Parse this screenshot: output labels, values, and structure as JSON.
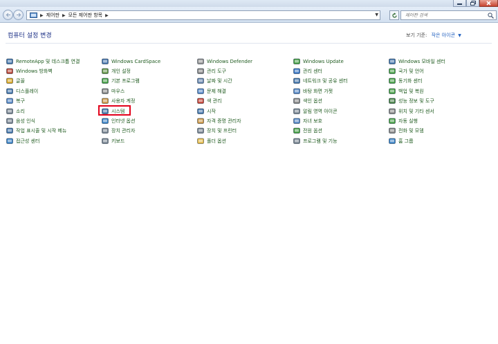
{
  "address": {
    "crumbs": [
      "제어판",
      "모든 제어판 항목"
    ]
  },
  "search": {
    "placeholder": "제어판 검색"
  },
  "content": {
    "title": "컴퓨터 설정 변경",
    "view_by_label": "보기 기준:",
    "view_by_value": "작은 아이콘"
  },
  "items": [
    {
      "label": "RemoteApp 및 데스크톱 연결",
      "icon": "remoteapp-icon",
      "color": "#3a6ea5"
    },
    {
      "label": "Windows 방화벽",
      "icon": "firewall-icon",
      "color": "#b33a2a"
    },
    {
      "label": "글꼴",
      "icon": "fonts-icon",
      "color": "#d4a017"
    },
    {
      "label": "디스플레이",
      "icon": "display-icon",
      "color": "#3a6ea5"
    },
    {
      "label": "복구",
      "icon": "recovery-icon",
      "color": "#4a7fc0"
    },
    {
      "label": "소리",
      "icon": "speaker-icon",
      "color": "#6f7c89"
    },
    {
      "label": "음성 인식",
      "icon": "microphone-icon",
      "color": "#6f7c89"
    },
    {
      "label": "작업 표시줄 및 시작 메뉴",
      "icon": "taskbar-icon",
      "color": "#3a6ea5"
    },
    {
      "label": "접근성 센터",
      "icon": "ease-of-access-icon",
      "color": "#2f7bc1"
    },
    {
      "label": "Windows CardSpace",
      "icon": "cardspace-icon",
      "color": "#3f6fa8"
    },
    {
      "label": "개인 설정",
      "icon": "personalization-icon",
      "color": "#5a8f3c"
    },
    {
      "label": "기본 프로그램",
      "icon": "default-programs-icon",
      "color": "#3c9a3c"
    },
    {
      "label": "마우스",
      "icon": "mouse-icon",
      "color": "#7c7c7c"
    },
    {
      "label": "사용자 계정",
      "icon": "user-accounts-icon",
      "color": "#c58f3a"
    },
    {
      "label": "시스템",
      "icon": "system-icon",
      "color": "#3a6ea5"
    },
    {
      "label": "인터넷 옵션",
      "icon": "internet-options-icon",
      "color": "#2f7bc1"
    },
    {
      "label": "장치 관리자",
      "icon": "device-manager-icon",
      "color": "#6f7c89"
    },
    {
      "label": "키보드",
      "icon": "keyboard-icon",
      "color": "#6f7c89"
    },
    {
      "label": "Windows Defender",
      "icon": "defender-icon",
      "color": "#8a8a8a"
    },
    {
      "label": "관리 도구",
      "icon": "admin-tools-icon",
      "color": "#7c7c7c"
    },
    {
      "label": "날짜 및 시간",
      "icon": "clock-icon",
      "color": "#5d7fa8"
    },
    {
      "label": "문제 해결",
      "icon": "troubleshoot-icon",
      "color": "#4a7fc0"
    },
    {
      "label": "색 관리",
      "icon": "color-management-icon",
      "color": "#c0392b"
    },
    {
      "label": "시작",
      "icon": "getting-started-icon",
      "color": "#3a6ea5"
    },
    {
      "label": "자격 증명 관리자",
      "icon": "credential-manager-icon",
      "color": "#c58f3a"
    },
    {
      "label": "장치 및 프린터",
      "icon": "printer-icon",
      "color": "#6f7c89"
    },
    {
      "label": "폴더 옵션",
      "icon": "folder-icon",
      "color": "#e0b43c"
    },
    {
      "label": "Windows Update",
      "icon": "windows-update-icon",
      "color": "#3c9a3c"
    },
    {
      "label": "관리 센터",
      "icon": "action-center-icon",
      "color": "#2f6fc1"
    },
    {
      "label": "네트워크 및 공유 센터",
      "icon": "network-icon",
      "color": "#3a6ea5"
    },
    {
      "label": "바탕 화면 가젯",
      "icon": "gadgets-icon",
      "color": "#4a7fc0"
    },
    {
      "label": "색인 옵션",
      "icon": "indexing-icon",
      "color": "#7c7c7c"
    },
    {
      "label": "알림 영역 아이콘",
      "icon": "notification-area-icon",
      "color": "#6f7c89"
    },
    {
      "label": "자녀 보호",
      "icon": "parental-controls-icon",
      "color": "#4a7fc0"
    },
    {
      "label": "전원 옵션",
      "icon": "power-icon",
      "color": "#3c9a3c"
    },
    {
      "label": "프로그램 및 기능",
      "icon": "programs-features-icon",
      "color": "#6f7c89"
    },
    {
      "label": "Windows 모바일 센터",
      "icon": "mobility-center-icon",
      "color": "#3a6ea5"
    },
    {
      "label": "국가 및 언어",
      "icon": "region-language-icon",
      "color": "#3c9a3c"
    },
    {
      "label": "동기화 센터",
      "icon": "sync-center-icon",
      "color": "#3c9a3c"
    },
    {
      "label": "백업 및 복원",
      "icon": "backup-icon",
      "color": "#3c9a3c"
    },
    {
      "label": "성능 정보 및 도구",
      "icon": "performance-icon",
      "color": "#3c7a3c"
    },
    {
      "label": "위치 및 기타 센서",
      "icon": "sensors-icon",
      "color": "#7c7c7c"
    },
    {
      "label": "자동 실행",
      "icon": "autoplay-icon",
      "color": "#3c9a3c"
    },
    {
      "label": "전화 및 모뎀",
      "icon": "phone-modem-icon",
      "color": "#7c7c7c"
    },
    {
      "label": "홈 그룹",
      "icon": "homegroup-icon",
      "color": "#2f7bc1"
    }
  ],
  "colors": {
    "highlight_border": "#e2001a",
    "link": "#1f5b1f",
    "title": "#1e3287"
  }
}
